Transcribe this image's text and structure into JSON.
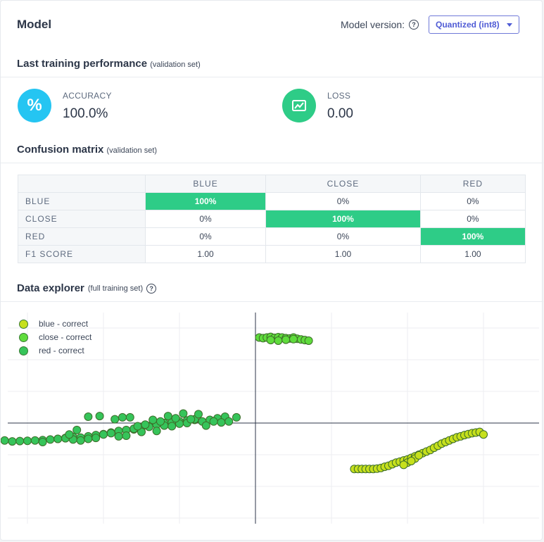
{
  "header": {
    "title": "Model",
    "version_label": "Model version:",
    "version_value": "Quantized (int8)"
  },
  "performance": {
    "title": "Last training performance",
    "subtitle": "(validation set)",
    "accuracy": {
      "label": "ACCURACY",
      "value": "100.0%",
      "icon": "percent-icon",
      "color": "#25c5f2"
    },
    "loss": {
      "label": "LOSS",
      "value": "0.00",
      "icon": "chart-icon",
      "color": "#2ecc87"
    }
  },
  "confusion": {
    "title": "Confusion matrix",
    "subtitle": "(validation set)",
    "columns": [
      "BLUE",
      "CLOSE",
      "RED"
    ],
    "rows": [
      {
        "label": "BLUE",
        "cells": [
          "100%",
          "0%",
          "0%"
        ]
      },
      {
        "label": "CLOSE",
        "cells": [
          "0%",
          "100%",
          "0%"
        ]
      },
      {
        "label": "RED",
        "cells": [
          "0%",
          "0%",
          "100%"
        ]
      },
      {
        "label": "F1 SCORE",
        "cells": [
          "1.00",
          "1.00",
          "1.00"
        ]
      }
    ],
    "highlight_color": "#2ecc87"
  },
  "explorer": {
    "title": "Data explorer",
    "subtitle": "(full training set)",
    "legend": [
      {
        "label": "blue - correct",
        "color": "#c6e01c"
      },
      {
        "label": "close - correct",
        "color": "#5fdc3c"
      },
      {
        "label": "red - correct",
        "color": "#36c45a"
      }
    ]
  },
  "chart_data": {
    "type": "scatter",
    "xlim": [
      -3.2,
      3.8
    ],
    "ylim": [
      -3.2,
      3.5
    ],
    "grid": true,
    "legend_position": "top-left",
    "series": [
      {
        "name": "blue - correct",
        "color": "#c6e01c",
        "x": [
          1.3,
          1.35,
          1.4,
          1.45,
          1.5,
          1.55,
          1.6,
          1.65,
          1.7,
          1.75,
          1.8,
          1.85,
          1.9,
          1.95,
          2.0,
          2.05,
          2.1,
          2.15,
          2.2,
          2.25,
          2.3,
          2.35,
          2.4,
          2.45,
          2.5,
          2.55,
          2.6,
          2.65,
          2.7,
          2.75,
          2.8,
          2.85,
          2.9,
          2.95,
          3.0,
          2.0,
          2.1,
          1.95,
          2.05,
          2.15
        ],
        "y": [
          -1.45,
          -1.45,
          -1.45,
          -1.45,
          -1.45,
          -1.45,
          -1.44,
          -1.42,
          -1.38,
          -1.35,
          -1.3,
          -1.25,
          -1.22,
          -1.18,
          -1.15,
          -1.1,
          -1.05,
          -1.0,
          -0.95,
          -0.9,
          -0.85,
          -0.78,
          -0.72,
          -0.65,
          -0.6,
          -0.55,
          -0.5,
          -0.45,
          -0.42,
          -0.38,
          -0.35,
          -0.32,
          -0.3,
          -0.28,
          -0.36,
          -1.25,
          -1.12,
          -1.32,
          -1.2,
          -1.02
        ]
      },
      {
        "name": "close - correct",
        "color": "#5fdc3c",
        "x": [
          0.05,
          0.1,
          0.15,
          0.2,
          0.25,
          0.3,
          0.35,
          0.4,
          0.45,
          0.5,
          0.55,
          0.6,
          0.65,
          0.7,
          0.2,
          0.3,
          0.4,
          0.5
        ],
        "y": [
          2.7,
          2.68,
          2.7,
          2.72,
          2.69,
          2.71,
          2.7,
          2.68,
          2.67,
          2.7,
          2.66,
          2.64,
          2.62,
          2.6,
          2.62,
          2.6,
          2.63,
          2.65
        ]
      },
      {
        "name": "red - correct",
        "color": "#36c45a",
        "x": [
          -3.3,
          -3.2,
          -3.1,
          -3.0,
          -2.9,
          -2.8,
          -2.7,
          -2.6,
          -2.5,
          -2.4,
          -2.3,
          -2.2,
          -2.1,
          -2.0,
          -1.9,
          -1.8,
          -1.7,
          -1.6,
          -1.5,
          -1.4,
          -1.3,
          -1.2,
          -1.1,
          -1.0,
          -0.9,
          -0.8,
          -0.7,
          -0.6,
          -0.5,
          -0.4,
          -2.5,
          -2.4,
          -2.3,
          -2.2,
          -2.1,
          -2.0,
          -1.9,
          -1.8,
          -1.7,
          -1.6,
          -1.5,
          -1.4,
          -1.3,
          -1.2,
          -1.1,
          -1.0,
          -0.9,
          -0.8,
          -2.8,
          -2.6,
          -2.45,
          -2.35,
          -1.85,
          -1.65,
          -1.45,
          -1.25,
          -1.05,
          -0.85,
          -0.65,
          -0.45,
          -0.35,
          -2.2,
          -2.05,
          -1.75,
          -1.55,
          -1.35,
          -1.15,
          -0.95,
          -0.75,
          -0.55,
          -0.25
        ],
        "y": [
          -0.55,
          -0.58,
          -0.57,
          -0.56,
          -0.55,
          -0.54,
          -0.52,
          -0.5,
          -0.47,
          -0.44,
          -0.46,
          -0.42,
          -0.38,
          -0.35,
          -0.3,
          -0.25,
          -0.22,
          -0.2,
          -0.15,
          -0.1,
          -0.05,
          0.0,
          0.02,
          0.05,
          0.08,
          0.1,
          0.05,
          0.1,
          0.15,
          0.2,
          -0.48,
          -0.52,
          -0.55,
          -0.5,
          -0.47,
          -0.36,
          -0.32,
          -0.42,
          -0.4,
          -0.18,
          -0.28,
          -0.12,
          -0.25,
          -0.08,
          -0.1,
          -0.02,
          0.0,
          0.12,
          -0.6,
          -0.5,
          -0.36,
          -0.22,
          0.12,
          0.18,
          -0.05,
          0.05,
          0.15,
          0.12,
          -0.08,
          0.02,
          0.05,
          0.2,
          0.22,
          0.18,
          -0.1,
          0.1,
          0.22,
          0.3,
          0.28,
          0.05,
          0.18
        ]
      }
    ]
  }
}
